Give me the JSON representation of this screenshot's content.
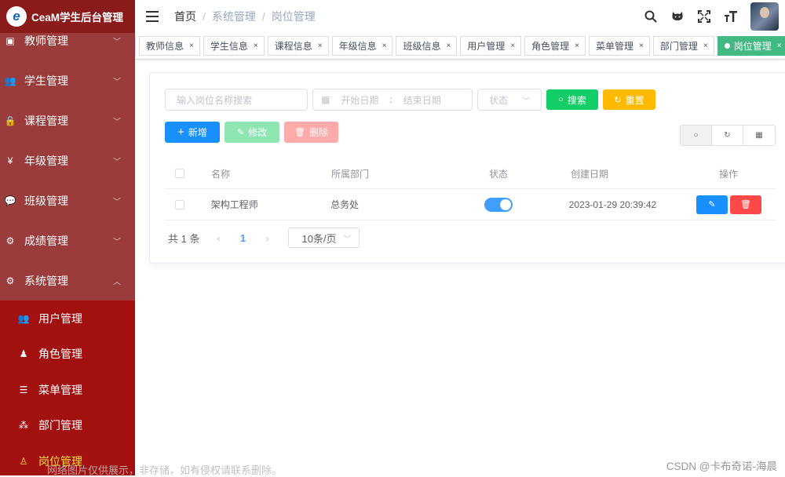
{
  "app": {
    "title": "CeaM学生后台管理",
    "logo_letter": "e"
  },
  "sidebar": {
    "items": [
      {
        "label": "教师管理",
        "icon": "calendar-icon"
      },
      {
        "label": "学生管理",
        "icon": "users-icon"
      },
      {
        "label": "课程管理",
        "icon": "lock-icon"
      },
      {
        "label": "年级管理",
        "icon": "money-icon"
      },
      {
        "label": "班级管理",
        "icon": "chat-icon"
      },
      {
        "label": "成绩管理",
        "icon": "gear-icon"
      },
      {
        "label": "系统管理",
        "icon": "settings-icon",
        "expanded": true
      }
    ],
    "submenu": [
      {
        "label": "用户管理",
        "icon": "user-icon"
      },
      {
        "label": "角色管理",
        "icon": "role-icon"
      },
      {
        "label": "菜单管理",
        "icon": "menu-list-icon"
      },
      {
        "label": "部门管理",
        "icon": "tree-icon"
      },
      {
        "label": "岗位管理",
        "icon": "post-icon",
        "active": true
      }
    ]
  },
  "breadcrumb": [
    "首页",
    "系统管理",
    "岗位管理"
  ],
  "navbar": {
    "icons": [
      "search-icon",
      "github-icon",
      "fullscreen-icon",
      "font-size-icon",
      "avatar"
    ]
  },
  "tags": [
    "教师信息",
    "学生信息",
    "课程信息",
    "年级信息",
    "班级信息",
    "用户管理",
    "角色管理",
    "菜单管理",
    "部门管理",
    "岗位管理"
  ],
  "active_tag": "岗位管理",
  "search": {
    "name_placeholder": "输入岗位名称搜索",
    "start_placeholder": "开始日期",
    "date_sep": ":",
    "end_placeholder": "结束日期",
    "status_placeholder": "状态",
    "search_label": "搜索",
    "reset_label": "重置"
  },
  "toolbar": {
    "add_label": "新增",
    "edit_label": "修改",
    "delete_label": "删除"
  },
  "table": {
    "headers": {
      "name": "名称",
      "dept": "所属部门",
      "status": "状态",
      "created": "创建日期",
      "ops": "操作"
    },
    "rows": [
      {
        "name": "架构工程师",
        "dept": "总务处",
        "status_on": true,
        "created": "2023-01-29 20:39:42"
      }
    ]
  },
  "pagination": {
    "total_text": "共 1 条",
    "current_page": "1",
    "page_size": "10条/页"
  },
  "watermarks": {
    "left": "网络图片仅供展示，非存储，如有侵权请联系删除。",
    "right": "CSDN @卡布奇诺-海晨"
  },
  "colors": {
    "sidebar_bg": "#8b1a1a",
    "submenu_bg": "#a31010",
    "active_tag": "#42b983",
    "primary": "#1890ff",
    "success": "#13ce66",
    "warning": "#ffba00",
    "danger": "#ff4949"
  }
}
